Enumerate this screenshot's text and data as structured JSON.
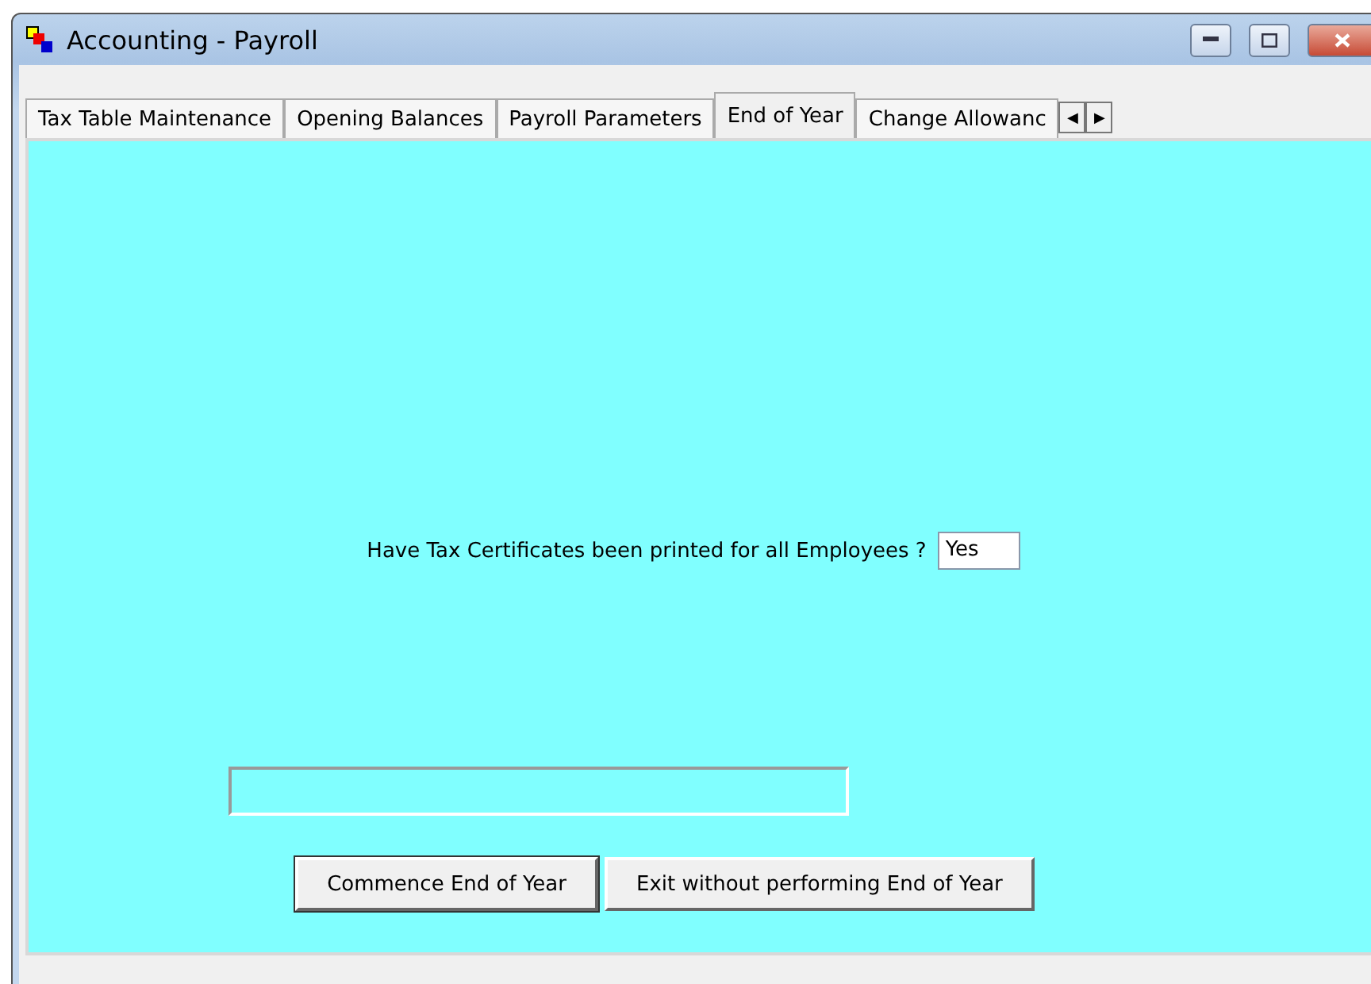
{
  "window": {
    "title": "Accounting - Payroll"
  },
  "title_buttons": [
    {
      "kind": "minimize"
    },
    {
      "kind": "maximize"
    },
    {
      "kind": "close"
    }
  ],
  "tabs": [
    {
      "label": "Tax Table Maintenance",
      "selected": false
    },
    {
      "label": "Opening Balances",
      "selected": false
    },
    {
      "label": "Payroll Parameters",
      "selected": false
    },
    {
      "label": "End of Year",
      "selected": true
    },
    {
      "label": "Change Allowanc",
      "selected": false
    }
  ],
  "tab_scroll": [
    "◀",
    "▶"
  ],
  "question": {
    "label": "Have Tax Certificates been printed for all Employees ?",
    "value": "Yes"
  },
  "buttons": [
    "Commence End of Year",
    "Exit without performing End of Year"
  ]
}
